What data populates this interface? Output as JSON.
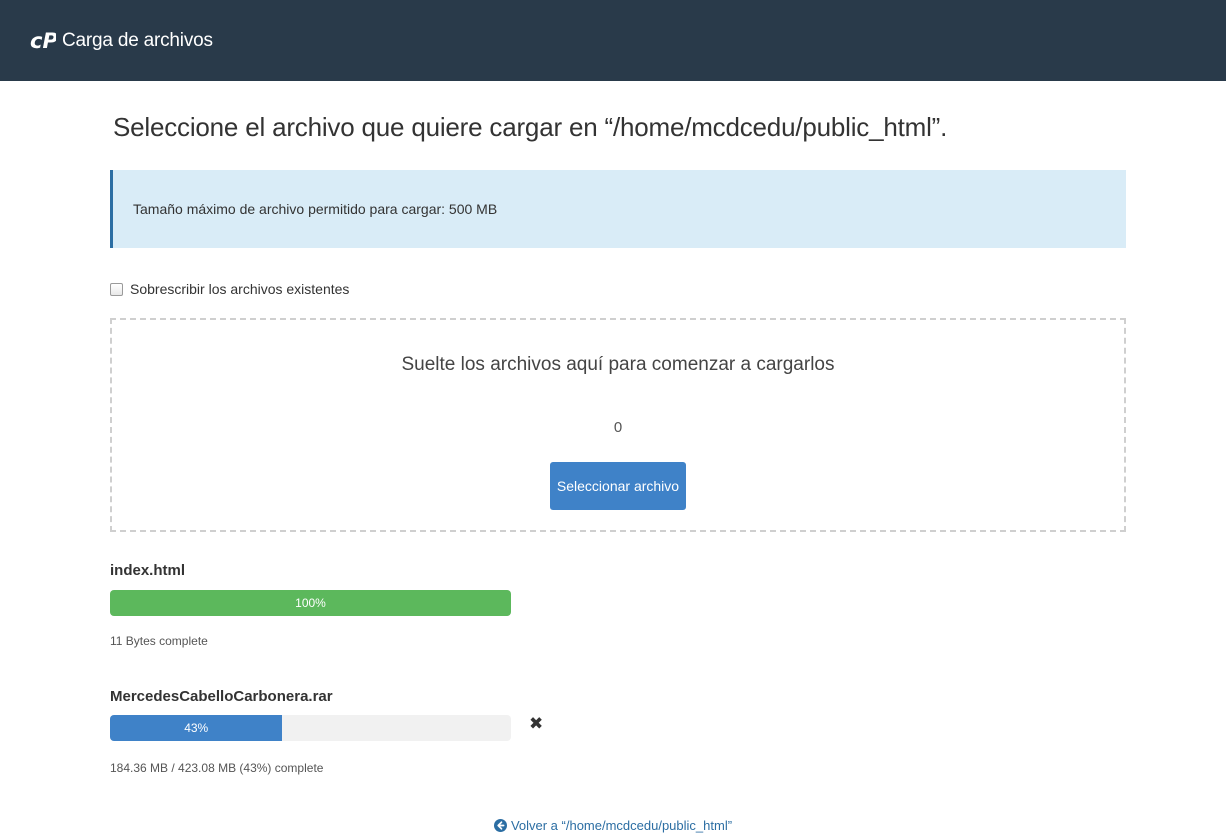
{
  "colors": {
    "header_bg": "#293a4a",
    "info_bg": "#d9ecf7",
    "info_border": "#2c6ea3",
    "primary_button": "#3f82c8",
    "progress_complete": "#5cb85c",
    "progress_active": "#3f82c8",
    "link": "#2c6ea3"
  },
  "header": {
    "logo_icon": "cpanel-logo-icon",
    "title": "Carga de archivos"
  },
  "main": {
    "title": "Seleccione el archivo que quiere cargar en “/home/mcdcedu/public_html”.",
    "info": "Tamaño máximo de archivo permitido para cargar: 500 MB",
    "overwrite_label": "Sobrescribir los archivos existentes",
    "overwrite_checked": false
  },
  "dropzone": {
    "text": "Suelte los archivos aquí para comenzar a cargarlos",
    "count": "0",
    "button_label": "Seleccionar archivo"
  },
  "uploads": [
    {
      "name": "index.html",
      "percent": 100,
      "percent_label": "100%",
      "status": "11 Bytes complete",
      "state": "complete"
    },
    {
      "name": "MercedesCabelloCarbonera.rar",
      "percent": 43,
      "percent_label": "43%",
      "status": "184.36 MB / 423.08 MB (43%) complete",
      "state": "uploading",
      "cancel_icon": "close-icon",
      "cancel_glyph": "✖"
    }
  ],
  "footer": {
    "back_icon": "arrow-circle-left-icon",
    "back_link": "Volver a “/home/mcdcedu/public_html”"
  }
}
